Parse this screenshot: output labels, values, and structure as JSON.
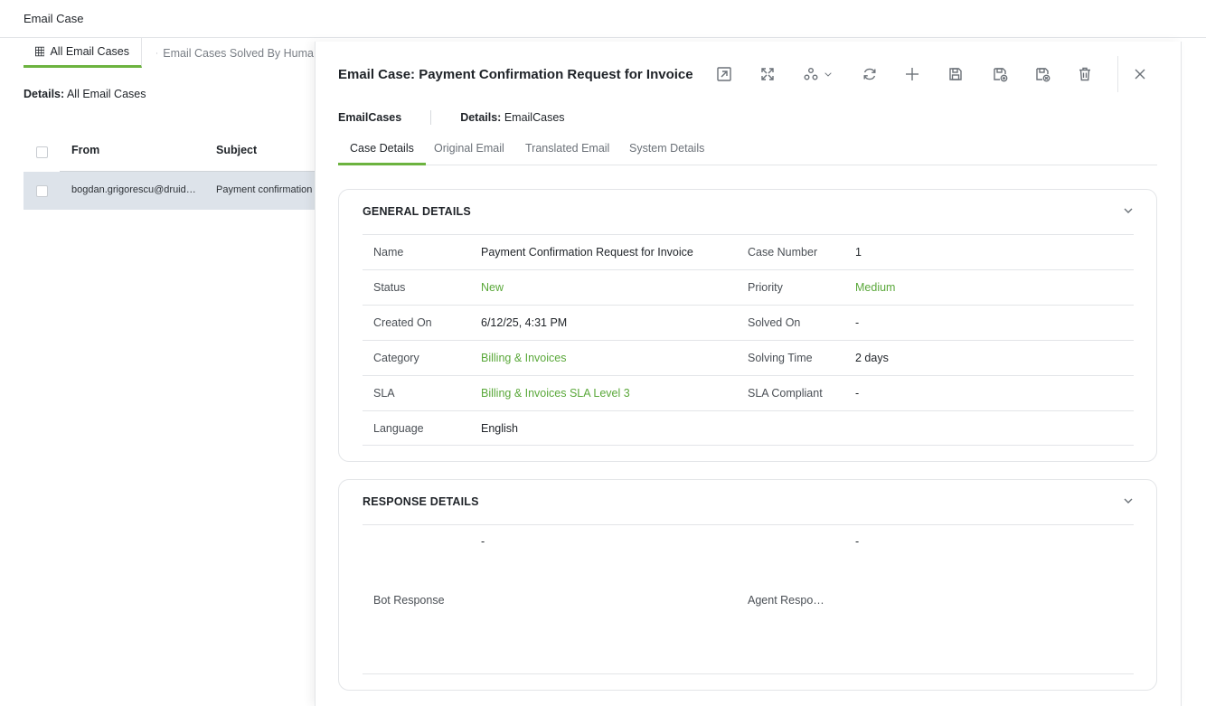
{
  "app": {
    "title": "Email Case"
  },
  "list": {
    "tabs": [
      {
        "label": "All Email Cases"
      },
      {
        "label": "Email Cases Solved By Huma"
      }
    ],
    "details_label": "Details:",
    "details_value": "All Email Cases",
    "columns": [
      "From",
      "Subject"
    ],
    "rows": [
      {
        "from": "bogdan.grigorescu@druid…",
        "subject": "Payment confirmation fo"
      }
    ]
  },
  "panel": {
    "title": "Email Case: Payment Confirmation Request for Invoice",
    "toolbar": [
      {
        "name": "open-in-new-icon"
      },
      {
        "name": "expand-icon"
      },
      {
        "name": "workflow-icon"
      },
      {
        "name": "refresh-icon"
      },
      {
        "name": "add-icon"
      },
      {
        "name": "save-icon"
      },
      {
        "name": "save-and-new-icon"
      },
      {
        "name": "save-and-close-icon"
      },
      {
        "name": "delete-icon"
      },
      {
        "name": "close-icon"
      }
    ],
    "entity": "EmailCases",
    "details_label": "Details:",
    "details_value": "EmailCases",
    "tabs": [
      "Case Details",
      "Original Email",
      "Translated Email",
      "System Details"
    ],
    "general": {
      "title": "GENERAL DETAILS",
      "rows": [
        {
          "l1": "Name",
          "v1": "Payment Confirmation Request for Invoice",
          "l2": "Case Number",
          "v2": "1"
        },
        {
          "l1": "Status",
          "v1": "New",
          "l2": "Priority",
          "v2": "Medium"
        },
        {
          "l1": "Created On",
          "v1": "6/12/25, 4:31 PM",
          "l2": "Solved On",
          "v2": "-"
        },
        {
          "l1": "Category",
          "v1": "Billing & Invoices",
          "l2": "Solving Time",
          "v2": "2 days"
        },
        {
          "l1": "SLA",
          "v1": "Billing & Invoices SLA Level 3",
          "l2": "SLA Compliant",
          "v2": "-"
        },
        {
          "l1": "Language",
          "v1": "English",
          "l2": "",
          "v2": ""
        }
      ]
    },
    "response": {
      "title": "RESPONSE DETAILS",
      "bot_label": "Bot Response",
      "bot_value": "-",
      "agent_label": "Agent Respo…",
      "agent_value": "-"
    }
  },
  "colors": {
    "accent": "#6cb33f",
    "link": "#5aa83a"
  }
}
